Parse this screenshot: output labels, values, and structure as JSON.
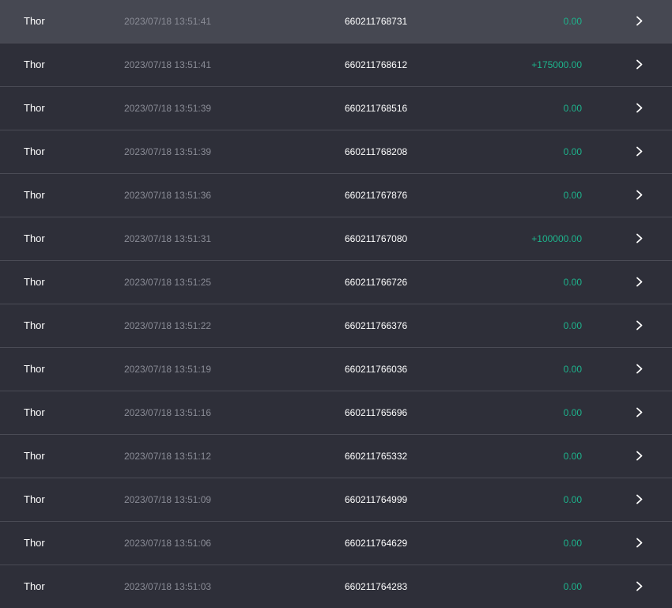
{
  "history": {
    "rows": [
      {
        "game": "Thor",
        "time": "2023/07/18 13:51:41",
        "id": "660211768731",
        "amount": "0.00",
        "hover": true
      },
      {
        "game": "Thor",
        "time": "2023/07/18 13:51:41",
        "id": "660211768612",
        "amount": "+175000.00"
      },
      {
        "game": "Thor",
        "time": "2023/07/18 13:51:39",
        "id": "660211768516",
        "amount": "0.00"
      },
      {
        "game": "Thor",
        "time": "2023/07/18 13:51:39",
        "id": "660211768208",
        "amount": "0.00"
      },
      {
        "game": "Thor",
        "time": "2023/07/18 13:51:36",
        "id": "660211767876",
        "amount": "0.00"
      },
      {
        "game": "Thor",
        "time": "2023/07/18 13:51:31",
        "id": "660211767080",
        "amount": "+100000.00"
      },
      {
        "game": "Thor",
        "time": "2023/07/18 13:51:25",
        "id": "660211766726",
        "amount": "0.00"
      },
      {
        "game": "Thor",
        "time": "2023/07/18 13:51:22",
        "id": "660211766376",
        "amount": "0.00"
      },
      {
        "game": "Thor",
        "time": "2023/07/18 13:51:19",
        "id": "660211766036",
        "amount": "0.00"
      },
      {
        "game": "Thor",
        "time": "2023/07/18 13:51:16",
        "id": "660211765696",
        "amount": "0.00"
      },
      {
        "game": "Thor",
        "time": "2023/07/18 13:51:12",
        "id": "660211765332",
        "amount": "0.00"
      },
      {
        "game": "Thor",
        "time": "2023/07/18 13:51:09",
        "id": "660211764999",
        "amount": "0.00"
      },
      {
        "game": "Thor",
        "time": "2023/07/18 13:51:06",
        "id": "660211764629",
        "amount": "0.00"
      },
      {
        "game": "Thor",
        "time": "2023/07/18 13:51:03",
        "id": "660211764283",
        "amount": "0.00"
      }
    ],
    "icon": "chevron-right-icon",
    "colors": {
      "background": "#2e2f39",
      "hover_row": "#464852",
      "amount": "#1db48c",
      "divider": "#4a4b55"
    }
  }
}
